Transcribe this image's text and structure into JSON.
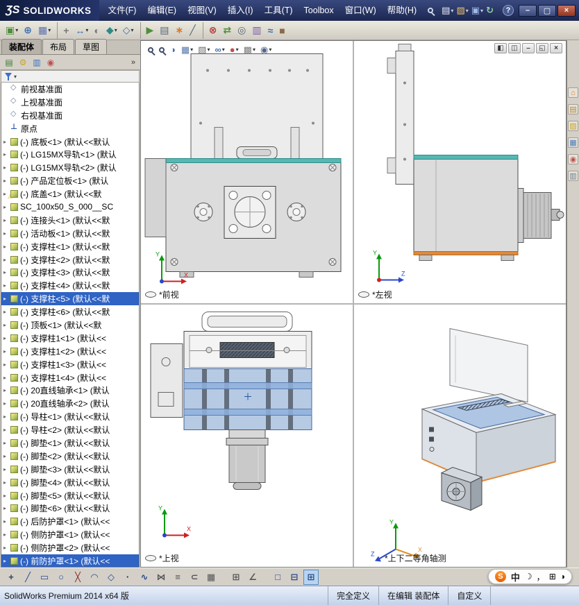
{
  "titlebar": {
    "logo_mark": "ƷS",
    "brand": "SOLIDWORKS",
    "menus": [
      "文件(F)",
      "编辑(E)",
      "视图(V)",
      "插入(I)",
      "工具(T)",
      "Toolbox",
      "窗口(W)",
      "帮助(H)"
    ],
    "quick_access": [
      {
        "name": "new-document-icon",
        "glyph": "▤",
        "color": "#eef2fa",
        "arrow": "▾"
      },
      {
        "name": "open-document-icon",
        "glyph": "▨",
        "color": "#f0c36d",
        "arrow": "▾"
      },
      {
        "name": "save-icon",
        "glyph": "▣",
        "color": "#9db8e8",
        "arrow": "▾"
      },
      {
        "name": "rebuild-icon",
        "glyph": "↻",
        "color": "#8fd0a0"
      }
    ],
    "help_label": "?",
    "window_buttons": [
      {
        "name": "minimize-button",
        "glyph": "–"
      },
      {
        "name": "maximize-button",
        "glyph": "▢"
      },
      {
        "name": "close-button",
        "glyph": "×"
      }
    ]
  },
  "main_toolbar": [
    {
      "name": "insert-components-icon",
      "glyph": "▣",
      "color": "#4e8f3a",
      "arrow": "▾"
    },
    {
      "name": "mate-icon",
      "glyph": "⊕",
      "color": "#3a6fb0"
    },
    {
      "name": "linear-component-pattern-icon",
      "glyph": "▦",
      "color": "#5a6fae",
      "arrow": "▾"
    },
    {
      "name": "smart-fasteners-icon",
      "glyph": "+",
      "color": "#777777",
      "sep": true
    },
    {
      "name": "move-component-icon",
      "glyph": "↔",
      "color": "#3a6fb0",
      "arrow": "▾"
    },
    {
      "name": "show-hidden-components-icon",
      "glyph": "◐",
      "color": "#777777"
    },
    {
      "name": "assembly-features-icon",
      "glyph": "◆",
      "color": "#2e8a87",
      "arrow": "▾"
    },
    {
      "name": "reference-geometry-icon",
      "glyph": "◇",
      "color": "#3a6fb0",
      "arrow": "▾"
    },
    {
      "name": "new-motion-study-icon",
      "glyph": "▶",
      "color": "#4e8f3a",
      "sep": true
    },
    {
      "name": "bill-of-materials-icon",
      "glyph": "▤",
      "color": "#556677"
    },
    {
      "name": "exploded-view-icon",
      "glyph": "∗",
      "color": "#d97b29"
    },
    {
      "name": "explode-line-sketch-icon",
      "glyph": "╱",
      "color": "#556677"
    },
    {
      "name": "interference-detection-icon",
      "glyph": "⊗",
      "color": "#b03a3a",
      "sep": true
    },
    {
      "name": "clearance-verification-icon",
      "glyph": "⇄",
      "color": "#4e8f3a"
    },
    {
      "name": "hole-alignment-icon",
      "glyph": "◎",
      "color": "#556677"
    },
    {
      "name": "assembly-visualization-icon",
      "glyph": "▥",
      "color": "#7a5aa0"
    },
    {
      "name": "instant3d-icon",
      "glyph": "≈",
      "color": "#3a6fb0"
    },
    {
      "name": "large-assembly-mode-icon",
      "glyph": "■",
      "color": "#8a6a4a"
    }
  ],
  "left_panel": {
    "tabs": [
      {
        "name": "tab-assembly",
        "label": "装配体",
        "active": true
      },
      {
        "name": "tab-layout",
        "label": "布局"
      },
      {
        "name": "tab-sketch",
        "label": "草图"
      }
    ],
    "manager_icons": [
      {
        "name": "featuremanager-tab-icon",
        "glyph": "▤",
        "color": "#3f7d2f"
      },
      {
        "name": "propertymanager-tab-icon",
        "glyph": "⚙",
        "color": "#c9a227"
      },
      {
        "name": "configurationmanager-tab-icon",
        "glyph": "▥",
        "color": "#3b6fbd"
      },
      {
        "name": "displaymanager-tab-icon",
        "glyph": "◉",
        "color": "#c0504d"
      }
    ],
    "overflow_label": "»",
    "filter_arrow": "▾",
    "tree": [
      {
        "label": "前视基准面",
        "type": "plane"
      },
      {
        "label": "上视基准面",
        "type": "plane"
      },
      {
        "label": "右视基准面",
        "type": "plane"
      },
      {
        "label": "原点",
        "type": "origin"
      },
      {
        "label": "(-) 底板<1> (默认<<默认",
        "type": "comp"
      },
      {
        "label": "(-) LG15MX导轨<1> (默认",
        "type": "comp"
      },
      {
        "label": "(-) LG15MX导轨<2> (默认",
        "type": "comp"
      },
      {
        "label": "(-) 产品定位板<1> (默认",
        "type": "comp"
      },
      {
        "label": "(-) 底盖<1> (默认<<默",
        "type": "warn"
      },
      {
        "label": "SC_100x50_S_000__SC",
        "type": "comp"
      },
      {
        "label": "(-) 连接头<1> (默认<<默",
        "type": "comp"
      },
      {
        "label": "(-) 活动板<1> (默认<<默",
        "type": "comp"
      },
      {
        "label": "(-) 支撑柱<1> (默认<<默",
        "type": "comp"
      },
      {
        "label": "(-) 支撑柱<2> (默认<<默",
        "type": "comp"
      },
      {
        "label": "(-) 支撑柱<3> (默认<<默",
        "type": "comp"
      },
      {
        "label": "(-) 支撑柱<4> (默认<<默",
        "type": "comp"
      },
      {
        "label": "(-) 支撑柱<5> (默认<<默",
        "type": "comp",
        "selected": true
      },
      {
        "label": "(-) 支撑柱<6> (默认<<默",
        "type": "comp"
      },
      {
        "label": "(-) 顶板<1> (默认<<默",
        "type": "comp"
      },
      {
        "label": "(-) 支撑柱1<1> (默认<<",
        "type": "comp"
      },
      {
        "label": "(-) 支撑柱1<2> (默认<<",
        "type": "comp"
      },
      {
        "label": "(-) 支撑柱1<3> (默认<<",
        "type": "comp"
      },
      {
        "label": "(-) 支撑柱1<4> (默认<<",
        "type": "comp"
      },
      {
        "label": "(-) 20直线轴承<1> (默认",
        "type": "comp"
      },
      {
        "label": "(-) 20直线轴承<2> (默认",
        "type": "comp"
      },
      {
        "label": "(-) 导柱<1> (默认<<默认",
        "type": "comp"
      },
      {
        "label": "(-) 导柱<2> (默认<<默认",
        "type": "comp"
      },
      {
        "label": "(-) 脚垫<1> (默认<<默认",
        "type": "comp"
      },
      {
        "label": "(-) 脚垫<2> (默认<<默认",
        "type": "comp"
      },
      {
        "label": "(-) 脚垫<3> (默认<<默认",
        "type": "comp"
      },
      {
        "label": "(-) 脚垫<4> (默认<<默认",
        "type": "comp"
      },
      {
        "label": "(-) 脚垫<5> (默认<<默认",
        "type": "comp"
      },
      {
        "label": "(-) 脚垫<6> (默认<<默认",
        "type": "comp"
      },
      {
        "label": "(-) 后防护罩<1> (默认<<",
        "type": "comp"
      },
      {
        "label": "(-) 侧防护罩<1> (默认<<",
        "type": "comp"
      },
      {
        "label": "(-) 侧防护罩<2> (默认<<",
        "type": "comp"
      },
      {
        "label": "(-) 前防护罩<1> (默认<<",
        "type": "comp",
        "selected": true
      }
    ]
  },
  "viewport": {
    "hud": [
      {
        "name": "zoom-fit-icon",
        "type": "mag"
      },
      {
        "name": "zoom-area-icon",
        "type": "mag"
      },
      {
        "name": "section-view-icon",
        "glyph": "◑",
        "color": "#4a6fae"
      },
      {
        "name": "view-orientation-icon",
        "glyph": "▦",
        "color": "#5577aa",
        "arrow": "▾"
      },
      {
        "name": "display-style-icon",
        "glyph": "▧",
        "color": "#666666",
        "arrow": "▾"
      },
      {
        "name": "hide-show-items-icon",
        "glyph": "∞",
        "color": "#3a6fb0",
        "arrow": "▾"
      },
      {
        "name": "edit-appearance-icon",
        "glyph": "●",
        "color": "#c0504d",
        "arrow": "▾"
      },
      {
        "name": "apply-scene-icon",
        "glyph": "▩",
        "color": "#7a7a7a",
        "arrow": "▾"
      },
      {
        "name": "view-settings-icon",
        "glyph": "◉",
        "color": "#556688",
        "arrow": "▾"
      }
    ],
    "window_controls": [
      {
        "name": "viewport-cascade-button",
        "glyph": "◧"
      },
      {
        "name": "viewport-tile-button",
        "glyph": "◫"
      },
      {
        "name": "viewport-minimize-button",
        "glyph": "–"
      },
      {
        "name": "viewport-restore-button",
        "glyph": "◱"
      },
      {
        "name": "viewport-close-button",
        "glyph": "×"
      }
    ],
    "panes": [
      {
        "label": "*前视"
      },
      {
        "label": "*左视"
      },
      {
        "label": "*上视"
      },
      {
        "label": "*上下二等角轴测"
      }
    ]
  },
  "axes": {
    "x": "X",
    "y": "Y",
    "z": "Z"
  },
  "task_pane": [
    {
      "name": "solidworks-resources-icon",
      "glyph": "⌂",
      "color": "#d97b29"
    },
    {
      "name": "design-library-icon",
      "glyph": "▤",
      "color": "#b08a3e"
    },
    {
      "name": "file-explorer-icon",
      "glyph": "▨",
      "color": "#c9a227"
    },
    {
      "name": "view-palette-icon",
      "glyph": "▦",
      "color": "#4a7ab5"
    },
    {
      "name": "appearances-icon",
      "glyph": "◉",
      "color": "#c0504d"
    },
    {
      "name": "custom-properties-icon",
      "glyph": "▥",
      "color": "#6a7a8a"
    }
  ],
  "sketch_toolbar": [
    {
      "name": "select-tool-icon",
      "glyph": "+",
      "color": "#33415c"
    },
    {
      "name": "line-tool-icon",
      "glyph": "╱",
      "color": "#2a4a8a"
    },
    {
      "name": "rectangle-tool-icon",
      "glyph": "▭",
      "color": "#2a4a8a"
    },
    {
      "name": "circle-tool-icon",
      "glyph": "○",
      "color": "#2a4a8a"
    },
    {
      "name": "trim-tool-icon",
      "glyph": "╳",
      "color": "#8a2a2a"
    },
    {
      "name": "arc-tool-icon",
      "glyph": "◠",
      "color": "#2a4a8a"
    },
    {
      "name": "polygon-tool-icon",
      "glyph": "◇",
      "color": "#2a4a8a"
    },
    {
      "name": "point-tool-icon",
      "glyph": "·",
      "color": "#222222"
    },
    {
      "name": "spline-tool-icon",
      "glyph": "∿",
      "color": "#2a4a8a"
    },
    {
      "name": "mirror-tool-icon",
      "glyph": "⋈",
      "color": "#555555"
    },
    {
      "name": "offset-tool-icon",
      "glyph": "≡",
      "color": "#555555"
    },
    {
      "name": "convert-entities-icon",
      "glyph": "⊂",
      "color": "#555555"
    },
    {
      "name": "pattern-tool-icon",
      "glyph": "▦",
      "color": "#555555"
    },
    {
      "name": "grid-snap-icon",
      "glyph": "⊞",
      "color": "#555555",
      "sep": true
    },
    {
      "name": "angle-tool-icon",
      "glyph": "∠",
      "color": "#555555"
    },
    {
      "name": "single-view-button",
      "glyph": "□",
      "color": "#2a4a8a",
      "sep": true
    },
    {
      "name": "two-view-button",
      "glyph": "⊟",
      "color": "#2a4a8a"
    },
    {
      "name": "four-view-button",
      "glyph": "⊞",
      "color": "#2a4a8a",
      "active": true
    }
  ],
  "status_bar": {
    "product": "SolidWorks Premium 2014 x64 版",
    "definition_state": "完全定义",
    "edit_state": "在编辑 装配体",
    "custom_tab": "自定义"
  },
  "ime_bar": {
    "logo": "S",
    "mode": "中",
    "icons": [
      {
        "name": "halfwidth-moon-icon",
        "glyph": "☽",
        "color": "#2f6fd0"
      },
      {
        "name": "punctuation-icon",
        "glyph": "，",
        "color": "#333333"
      },
      {
        "name": "soft-keyboard-icon",
        "glyph": "⊞",
        "color": "#556677"
      },
      {
        "name": "sogou-skin-icon",
        "glyph": "◑",
        "color": "#888888"
      }
    ]
  }
}
